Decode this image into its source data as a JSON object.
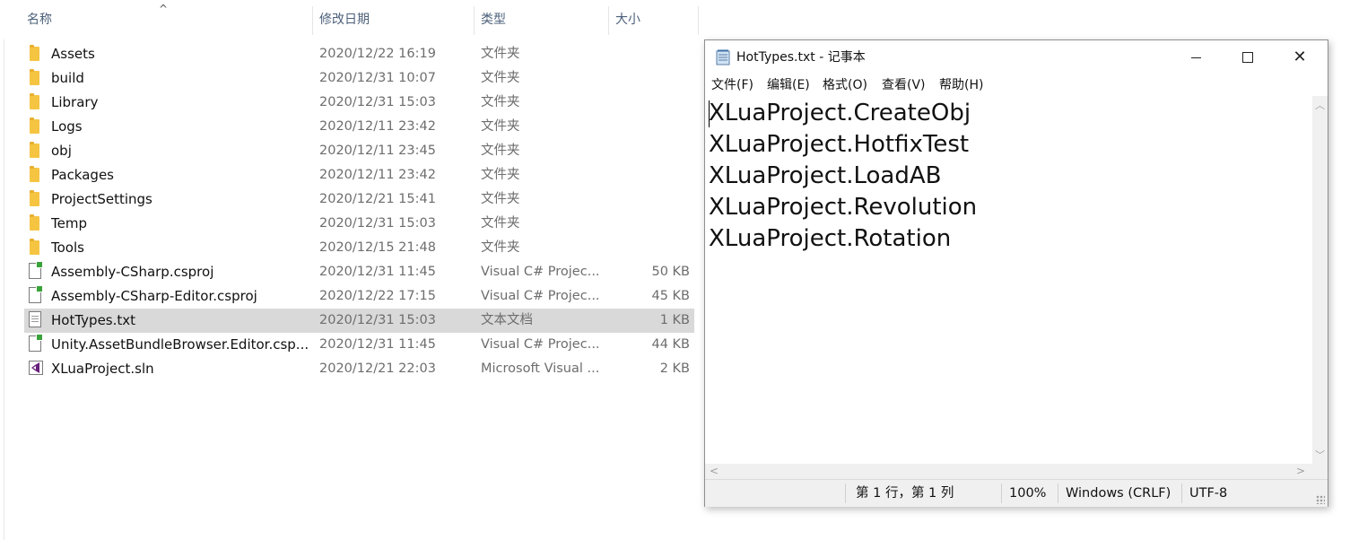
{
  "explorer": {
    "columns": {
      "name": "名称",
      "modified": "修改日期",
      "type": "类型",
      "size": "大小"
    },
    "sort_indicator": "^",
    "files": [
      {
        "name": "Assets",
        "modified": "2020/12/22 16:19",
        "type": "文件夹",
        "size": "",
        "icon": "folder-icon"
      },
      {
        "name": "build",
        "modified": "2020/12/31 10:07",
        "type": "文件夹",
        "size": "",
        "icon": "folder-icon"
      },
      {
        "name": "Library",
        "modified": "2020/12/31 15:03",
        "type": "文件夹",
        "size": "",
        "icon": "folder-icon"
      },
      {
        "name": "Logs",
        "modified": "2020/12/11 23:42",
        "type": "文件夹",
        "size": "",
        "icon": "folder-icon"
      },
      {
        "name": "obj",
        "modified": "2020/12/11 23:45",
        "type": "文件夹",
        "size": "",
        "icon": "folder-icon"
      },
      {
        "name": "Packages",
        "modified": "2020/12/11 23:42",
        "type": "文件夹",
        "size": "",
        "icon": "folder-icon"
      },
      {
        "name": "ProjectSettings",
        "modified": "2020/12/21 15:41",
        "type": "文件夹",
        "size": "",
        "icon": "folder-icon"
      },
      {
        "name": "Temp",
        "modified": "2020/12/31 15:03",
        "type": "文件夹",
        "size": "",
        "icon": "folder-icon"
      },
      {
        "name": "Tools",
        "modified": "2020/12/15 21:48",
        "type": "文件夹",
        "size": "",
        "icon": "folder-icon"
      },
      {
        "name": "Assembly-CSharp.csproj",
        "modified": "2020/12/31 11:45",
        "type": "Visual C# Projec...",
        "size": "50 KB",
        "icon": "csproj-file-icon"
      },
      {
        "name": "Assembly-CSharp-Editor.csproj",
        "modified": "2020/12/22 17:15",
        "type": "Visual C# Projec...",
        "size": "45 KB",
        "icon": "csproj-file-icon"
      },
      {
        "name": "HotTypes.txt",
        "modified": "2020/12/31 15:03",
        "type": "文本文档",
        "size": "1 KB",
        "icon": "text-file-icon",
        "selected": true
      },
      {
        "name": "Unity.AssetBundleBrowser.Editor.csp...",
        "modified": "2020/12/31 11:45",
        "type": "Visual C# Projec...",
        "size": "44 KB",
        "icon": "csproj-file-icon"
      },
      {
        "name": "XLuaProject.sln",
        "modified": "2020/12/21 22:03",
        "type": "Microsoft Visual ...",
        "size": "2 KB",
        "icon": "visual-studio-solution-icon"
      }
    ]
  },
  "notepad": {
    "title": "HotTypes.txt - 记事本",
    "menu": [
      "文件(F)",
      "编辑(E)",
      "格式(O)",
      "查看(V)",
      "帮助(H)"
    ],
    "lines": [
      "XLuaProject.CreateObj",
      "XLuaProject.HotfixTest",
      "XLuaProject.LoadAB",
      "XLuaProject.Revolution",
      "XLuaProject.Rotation"
    ],
    "status": {
      "position": "第 1 行，第 1 列",
      "zoom": "100%",
      "line_ending": "Windows (CRLF)",
      "encoding": "UTF-8"
    },
    "controls": {
      "minimize": "minimize-icon",
      "maximize": "maximize-icon",
      "close": "close-icon",
      "close_glyph": "✕"
    }
  }
}
